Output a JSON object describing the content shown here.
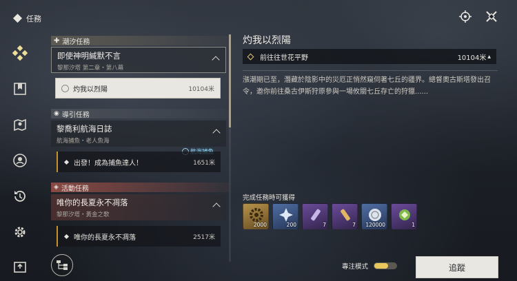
{
  "top": {
    "title": "任務"
  },
  "categories": {
    "tide": "潮汐任務",
    "guide": "導引任務",
    "event": "活動任務"
  },
  "quests": [
    {
      "name": "即使神明緘默不言",
      "sub": "黎那汐塔 第二章・第八幕",
      "task": "灼我以烈陽",
      "distance": "10104米"
    },
    {
      "name": "黎喬利航海日誌",
      "sub": "航海捕魚・老人魚海",
      "task": "出發！成為捕魚達人！",
      "distance": "1651米",
      "tag": "航海捕魚"
    },
    {
      "name": "唯你的長夏永不凋落",
      "sub": "黎那汐塔・黃金之歌",
      "task": "唯你的長夏永不凋落",
      "distance": "2517米"
    }
  ],
  "detail": {
    "title": "灼我以烈陽",
    "destination": "前往往世花平野",
    "distance": "10104米",
    "description": "漲潮期已至，潛藏於陰影中的災厄正悄然窺伺著七丘的疆界。總督奧古斯塔發出召令，邀你前往桑古伊斯狩原參與一場攸關七丘存亡的狩獵......",
    "rewards_label": "完成任務時可獲得",
    "rewards": [
      {
        "icon": "gear-icon",
        "quantity": "2000"
      },
      {
        "icon": "star-shard-icon",
        "quantity": "200"
      },
      {
        "icon": "potion-icon",
        "quantity": "7"
      },
      {
        "icon": "vial-icon",
        "quantity": "7"
      },
      {
        "icon": "shell-coin-icon",
        "quantity": "120000"
      },
      {
        "icon": "crest-icon",
        "quantity": "1"
      }
    ]
  },
  "footer": {
    "focus_label": "專注模式",
    "track_label": "追蹤"
  },
  "colors": {
    "accent_gold": "#e9c75c",
    "event_red": "#8a4a44",
    "panel_light": "#e9e7e2"
  }
}
